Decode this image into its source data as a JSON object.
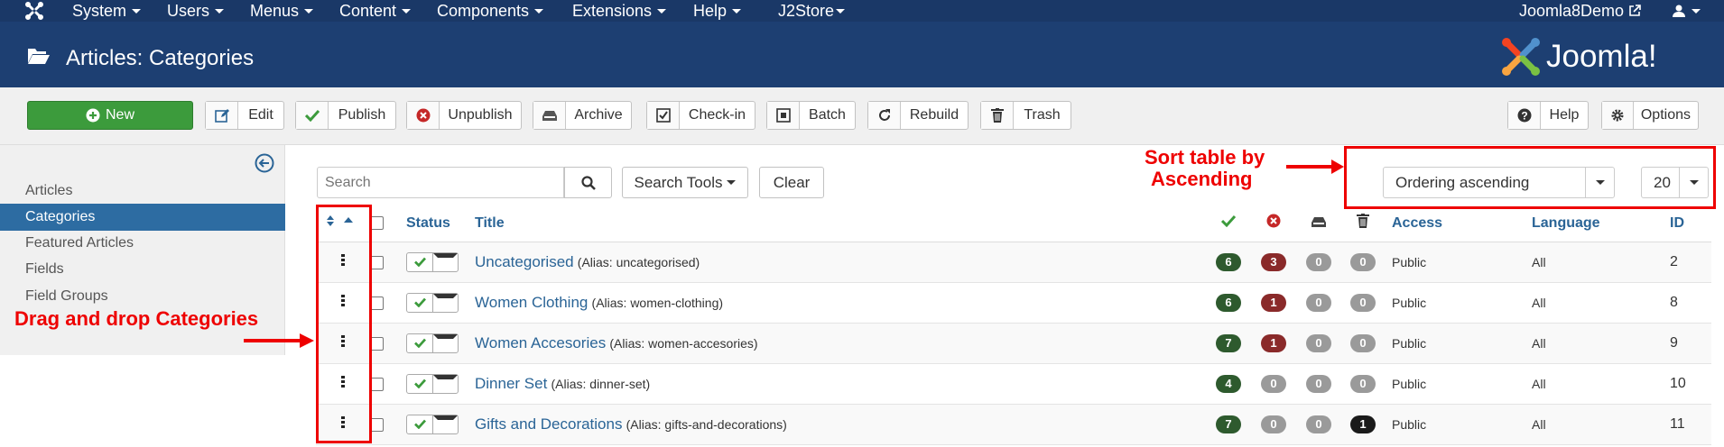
{
  "topnav": {
    "menus": [
      "System",
      "Users",
      "Menus",
      "Content",
      "Components",
      "Extensions",
      "Help",
      "J2Store"
    ],
    "site_link": "Joomla8Demo",
    "user_icon": "user-icon"
  },
  "header": {
    "title": "Articles: Categories",
    "logo_text": "Joomla!"
  },
  "toolbar": {
    "new": "New",
    "edit": "Edit",
    "publish": "Publish",
    "unpublish": "Unpublish",
    "archive": "Archive",
    "checkin": "Check-in",
    "batch": "Batch",
    "rebuild": "Rebuild",
    "trash": "Trash",
    "help": "Help",
    "options": "Options"
  },
  "sidebar": {
    "items": [
      {
        "label": "Articles"
      },
      {
        "label": "Categories"
      },
      {
        "label": "Featured Articles"
      },
      {
        "label": "Fields"
      },
      {
        "label": "Field Groups"
      }
    ],
    "active": "Categories"
  },
  "filters": {
    "search_placeholder": "Search",
    "search_tools": "Search Tools",
    "clear": "Clear",
    "ordering": "Ordering ascending",
    "limit": "20"
  },
  "table": {
    "headers": {
      "status": "Status",
      "title": "Title",
      "access": "Access",
      "language": "Language",
      "id": "ID"
    },
    "rows": [
      {
        "title": "Uncategorised",
        "alias": "(Alias: uncategorised)",
        "published": "6",
        "unpublished": "3",
        "archived": "0",
        "trashed": "0",
        "access": "Public",
        "language": "All",
        "id": "2"
      },
      {
        "title": "Women Clothing",
        "alias": "(Alias: women-clothing)",
        "published": "6",
        "unpublished": "1",
        "archived": "0",
        "trashed": "0",
        "access": "Public",
        "language": "All",
        "id": "8"
      },
      {
        "title": "Women Accesories",
        "alias": "(Alias: women-accesories)",
        "published": "7",
        "unpublished": "1",
        "archived": "0",
        "trashed": "0",
        "access": "Public",
        "language": "All",
        "id": "9"
      },
      {
        "title": "Dinner Set",
        "alias": "(Alias: dinner-set)",
        "published": "4",
        "unpublished": "0",
        "archived": "0",
        "trashed": "0",
        "access": "Public",
        "language": "All",
        "id": "10"
      },
      {
        "title": "Gifts and Decorations",
        "alias": "(Alias: gifts-and-decorations)",
        "published": "7",
        "unpublished": "0",
        "archived": "0",
        "trashed": "1",
        "access": "Public",
        "language": "All",
        "id": "11"
      }
    ]
  },
  "annotations": {
    "sort_line1": "Sort table by",
    "sort_line2": "Ascending",
    "drag": "Drag and drop Categories"
  },
  "colors": {
    "nav_bg": "#1a3867",
    "header_bg": "#1d3f72",
    "active_item": "#2d6ca2",
    "annotation": "#ee0000",
    "badge_published": "#2e5a2e",
    "badge_unpublished": "#8a2a2a",
    "badge_zero": "#9a9a9a",
    "badge_trash": "#1a1a1a"
  }
}
